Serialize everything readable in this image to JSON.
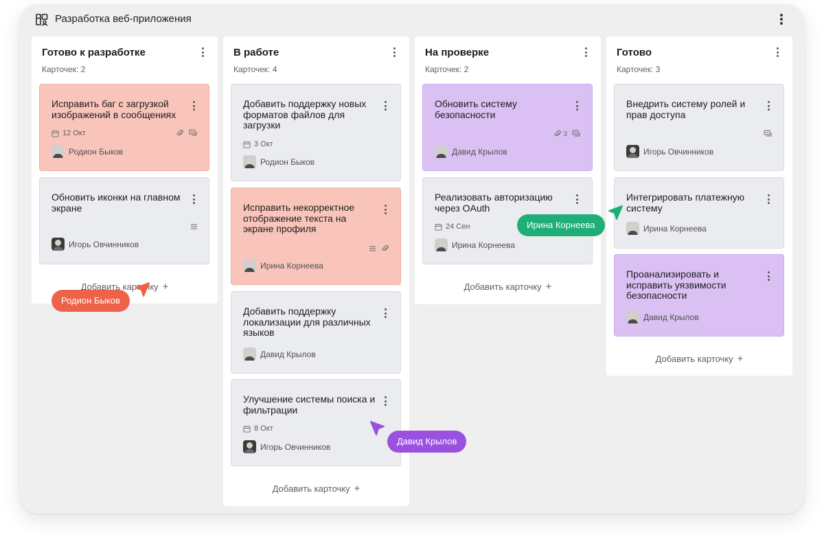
{
  "board": {
    "title": "Разработка веб-приложения",
    "icon": "board-icon",
    "menu_icon": "kebab-icon"
  },
  "columns": [
    {
      "title": "Готово к разработке",
      "count": "Карточек: 2",
      "add_label": "Добавить карточку",
      "cards": [
        {
          "title": "Исправить баг с загрузкой изображений в сообщениях",
          "date": "12 Окт",
          "assignee": "Родион Быков",
          "color": "red",
          "icons": [
            "paperclip-icon",
            "comment-icon"
          ]
        },
        {
          "title": "Обновить иконки на главном экране",
          "assignee": "Игорь Овчинников",
          "color": "gray",
          "icons": [
            "description-icon"
          ]
        }
      ]
    },
    {
      "title": "В работе",
      "count": "Карточек: 4",
      "add_label": "Добавить карточку",
      "cards": [
        {
          "title": "Добавить поддержку новых форматов файлов для загрузки",
          "date": "3 Окт",
          "assignee": "Родион Быков",
          "color": "gray"
        },
        {
          "title": "Исправить некорректное отображение текста на экране профиля",
          "assignee": "Ирина Корнеева",
          "color": "red",
          "icons": [
            "description-icon",
            "paperclip-icon"
          ]
        },
        {
          "title": "Добавить поддержку локализации для различных языков",
          "assignee": "Давид Крылов",
          "color": "gray"
        },
        {
          "title": "Улучшение системы поиска и фильтрации",
          "date": "8 Окт",
          "assignee": "Игорь Овчинников",
          "color": "gray"
        }
      ]
    },
    {
      "title": "На проверке",
      "count": "Карточек: 2",
      "add_label": "Добавить карточку",
      "cards": [
        {
          "title": "Обновить систему безопасности",
          "assignee": "Давид Крылов",
          "color": "purple",
          "attachments": "3",
          "icons": [
            "paperclip-icon",
            "comment-icon"
          ]
        },
        {
          "title": "Реализовать авторизацию через OAuth",
          "date": "24 Сен",
          "assignee": "Ирина Корнеева",
          "color": "gray"
        }
      ]
    },
    {
      "title": "Готово",
      "count": "Карточек: 3",
      "add_label": "Добавить карточку",
      "cards": [
        {
          "title": "Внедрить систему ролей и прав доступа",
          "assignee": "Игорь Овчинников",
          "color": "gray",
          "icons": [
            "comment-icon"
          ]
        },
        {
          "title": "Интегрировать платежную систему",
          "assignee": "Ирина Корнеева",
          "color": "gray"
        },
        {
          "title": "Проанализировать и исправить уязвимости безопасности",
          "assignee": "Давид Крылов",
          "color": "purple"
        }
      ]
    }
  ],
  "cursors": [
    {
      "name": "Родион Быков",
      "color": "#ec634a"
    },
    {
      "name": "Давид Крылов",
      "color": "#9b51e0"
    },
    {
      "name": "Ирина Корнеева",
      "color": "#1fae78"
    }
  ],
  "colors": {
    "card_red": "#f9c5bb",
    "card_purple": "#dbc1f3",
    "card_gray": "#ebecef",
    "background": "#efefef"
  }
}
